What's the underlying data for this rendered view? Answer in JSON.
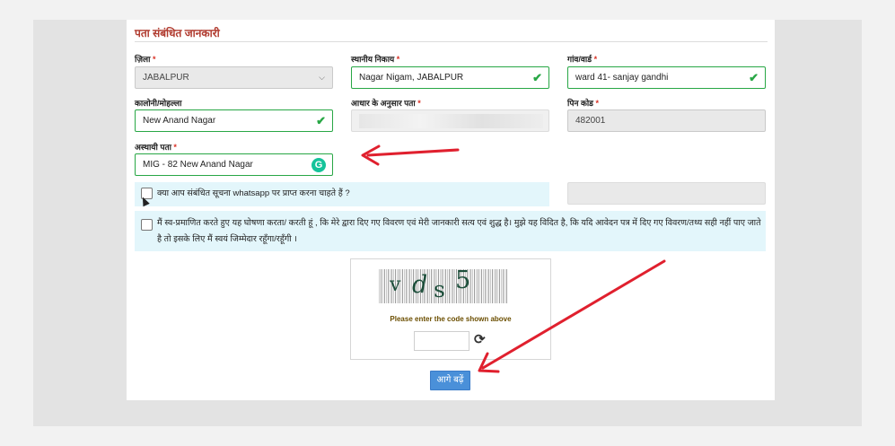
{
  "section": {
    "title": "पता संबंधित जानकारी"
  },
  "fields": {
    "district": {
      "label": "ज़िला",
      "value": "JABALPUR"
    },
    "local_body": {
      "label": "स्थानीय निकाय",
      "value": "Nagar Nigam, JABALPUR"
    },
    "village_ward": {
      "label": "गांव/वार्ड",
      "value": "ward 41- sanjay gandhi"
    },
    "colony": {
      "label": "कालोनी/मोहल्ला",
      "value": "New Anand Nagar"
    },
    "aadhaar_address": {
      "label": "आधार के अनुसार पता",
      "value": ""
    },
    "pincode": {
      "label": "पिन कोड",
      "value": "482001"
    },
    "temp_address": {
      "label": "अस्थायी पता",
      "value": "MIG - 82 New Anand Nagar"
    }
  },
  "required_mark": "*",
  "whatsapp": {
    "text": "क्या आप संबंधित सूचना whatsapp पर प्राप्त करना चाहते हैं ?",
    "checked": false
  },
  "declaration": {
    "line1": "मैं स्व-प्रमाणित करते हुए यह घोषणा करता/ करती हूं , कि मेरे द्वारा दिए गए विवरण एवं मेरी जानकारी सत्य एवं शुद्ध है। मुझे यह विदित है, कि यदि आवेदन पत्र में दिए गए विवरण/तथ्य सही नहीं पाए जाते",
    "line2": "है तो इसके लिए मैं स्वयं जिम्मेदार रहूँगा/रहूँगी ।",
    "checked": false
  },
  "captcha": {
    "chars": [
      "v",
      "d",
      "s",
      "5"
    ],
    "hint": "Please enter the code shown above",
    "input_value": ""
  },
  "submit_label": "आगे बढ़ें",
  "icons": {
    "check": "check-icon",
    "grammarly": "grammarly-icon",
    "refresh": "refresh-icon",
    "chevron": "chevron-down-icon"
  },
  "colors": {
    "valid": "#28a745",
    "section_title": "#b03a2e",
    "annotation_arrow": "#e0202e",
    "submit": "#4a90d9"
  }
}
